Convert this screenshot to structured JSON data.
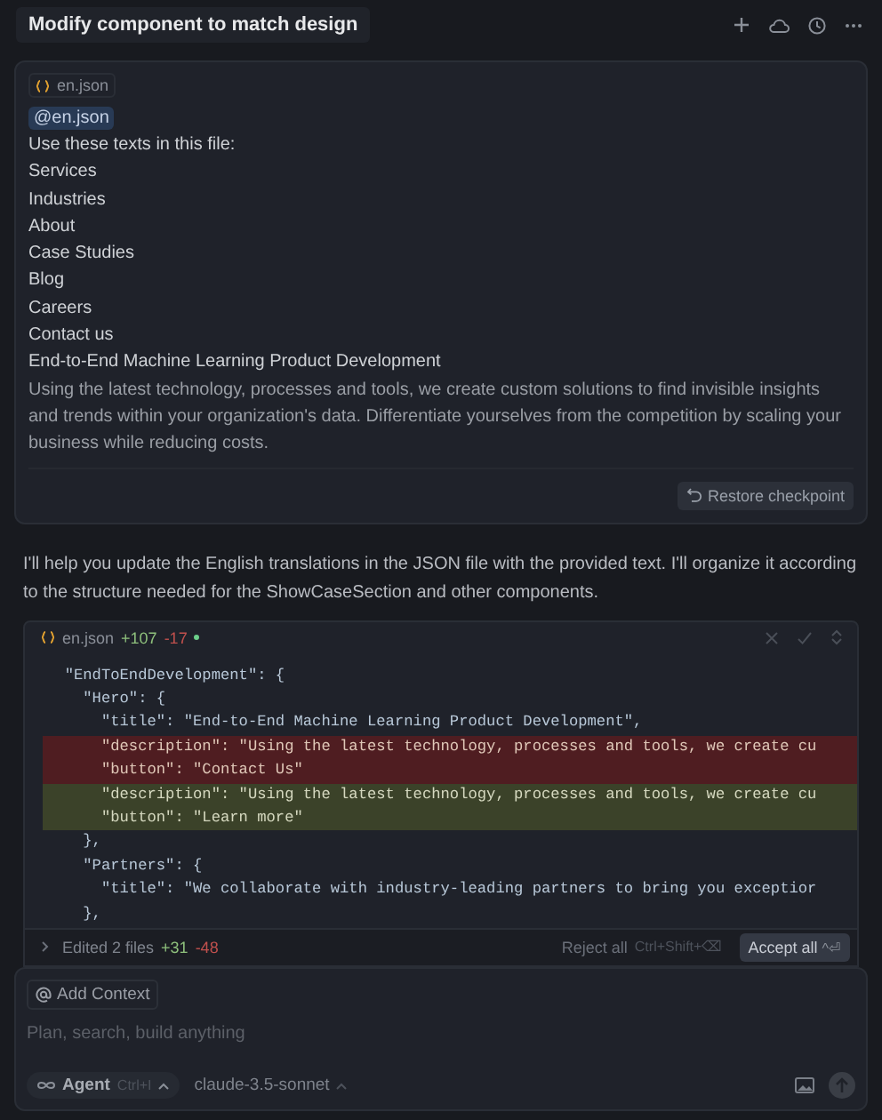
{
  "header": {
    "title": "Modify component to match design"
  },
  "user_message": {
    "file_chip": "en.json",
    "mention": "@en.json",
    "lines": [
      "Use these texts in this file:",
      "Services",
      "Industries",
      "About",
      "Case Studies",
      "Blog",
      "Careers",
      "Contact us",
      "End-to-End Machine Learning Product Development",
      "Using the latest technology, processes and tools, we create custom solutions to find invisible insights and trends within your organization's data. Differentiate yourselves from the competition by scaling your business while reducing costs."
    ],
    "restore_button": "Restore checkpoint"
  },
  "assistant_message": "I'll help you update the English translations in the JSON file with the provided text. I'll organize it according to the structure needed for the ShowCaseSection and other components.",
  "code_block": {
    "file": "en.json",
    "added": "+107",
    "removed": "-17",
    "lines": [
      {
        "kind": "context",
        "text": "  \"EndToEndDevelopment\": {"
      },
      {
        "kind": "context",
        "text": "    \"Hero\": {"
      },
      {
        "kind": "context",
        "text": "      \"title\": \"End-to-End Machine Learning Product Development\","
      },
      {
        "kind": "removed",
        "text": "      \"description\": \"Using the latest technology, processes and tools, we create cu"
      },
      {
        "kind": "removed",
        "text": "      \"button\": \"Contact Us\""
      },
      {
        "kind": "added",
        "text": "      \"description\": \"Using the latest technology, processes and tools, we create cu"
      },
      {
        "kind": "added",
        "text": "      \"button\": \"Learn more\""
      },
      {
        "kind": "context",
        "text": "    },"
      },
      {
        "kind": "context",
        "text": "    \"Partners\": {"
      },
      {
        "kind": "context",
        "text": "      \"title\": \"We collaborate with industry-leading partners to bring you exceptior"
      },
      {
        "kind": "context",
        "text": "    },"
      }
    ]
  },
  "edits_bar": {
    "label": "Edited 2 files",
    "added": "+31",
    "removed": "-48",
    "reject": "Reject all",
    "reject_shortcut": "Ctrl+Shift+⌫",
    "accept": "Accept all",
    "accept_shortcut": "^⏎"
  },
  "composer": {
    "add_context": "Add Context",
    "placeholder": "Plan, search, build anything",
    "mode": "Agent",
    "mode_shortcut": "Ctrl+I",
    "model": "claude-3.5-sonnet"
  }
}
